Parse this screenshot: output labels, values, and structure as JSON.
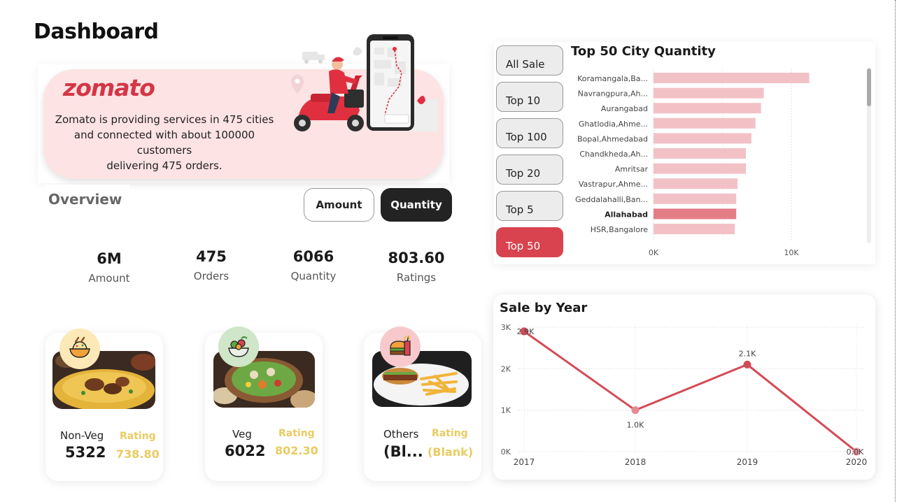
{
  "page": {
    "title": "Dashboard"
  },
  "hero": {
    "brand": "zomato",
    "lines": [
      "Zomato is providing services in 475 cities",
      "and connected with about 100000 customers",
      "delivering 475 orders."
    ],
    "illustration": "delivery-scooter-phone-illustration"
  },
  "overview": {
    "label": "Overview"
  },
  "toggle": {
    "amount": "Amount",
    "quantity": "Quantity",
    "selected": "Quantity"
  },
  "kpis": [
    {
      "value": "6M",
      "label": "Amount"
    },
    {
      "value": "475",
      "label": "Orders"
    },
    {
      "value": "6066",
      "label": "Quantity"
    },
    {
      "value": "803.60",
      "label": "Ratings"
    }
  ],
  "categories": [
    {
      "name": "Non-Veg",
      "value": "5322",
      "rating_label": "Rating",
      "rating": "738.80",
      "icon": "biryani-icon"
    },
    {
      "name": "Veg",
      "value": "6022",
      "rating_label": "Rating",
      "rating": "802.30",
      "icon": "salad-icon"
    },
    {
      "name": "Others",
      "value": "(Bl...",
      "rating_label": "Rating",
      "rating": "(Blank)",
      "icon": "fast-food-icon"
    }
  ],
  "slicer": {
    "items": [
      "All Sale",
      "Top 10",
      "Top 100",
      "Top 20",
      "Top 5",
      "Top 50"
    ],
    "selected": "Top 50"
  },
  "colors": {
    "accent": "#d8434f",
    "bar": "#f2c1c6",
    "bar_highlight": "#e57d86",
    "line": "#d34b57",
    "rating": "#e9cc62"
  },
  "chart_data": [
    {
      "type": "bar",
      "orientation": "horizontal",
      "title": "Top 50 City Quantity",
      "categories": [
        "Koramangala,Ba...",
        "Navrangpura,Ah...",
        "Aurangabad",
        "Ghatlodia,Ahme...",
        "Bopal,Ahmedabad",
        "Chandkheda,Ah...",
        "Amritsar",
        "Vastrapur,Ahme...",
        "Geddalahalli,Ban...",
        "Allahabad",
        "HSR,Bangalore"
      ],
      "values": [
        11300,
        8000,
        7800,
        7400,
        7100,
        6700,
        6700,
        6100,
        6000,
        6000,
        5900
      ],
      "highlighted": "Allahabad",
      "x_ticks": [
        "0K",
        "10K"
      ],
      "xlim": [
        0,
        13000
      ],
      "grid": true
    },
    {
      "type": "line",
      "title": "Sale by Year",
      "x": [
        "2017",
        "2018",
        "2019",
        "2020"
      ],
      "values": [
        2900,
        1000,
        2100,
        0
      ],
      "data_labels": [
        "2.9K",
        "1.0K",
        "2.1K",
        "0.0K"
      ],
      "y_ticks": [
        "0K",
        "1K",
        "2K",
        "3K"
      ],
      "ylim": [
        0,
        3000
      ],
      "grid": true
    }
  ]
}
